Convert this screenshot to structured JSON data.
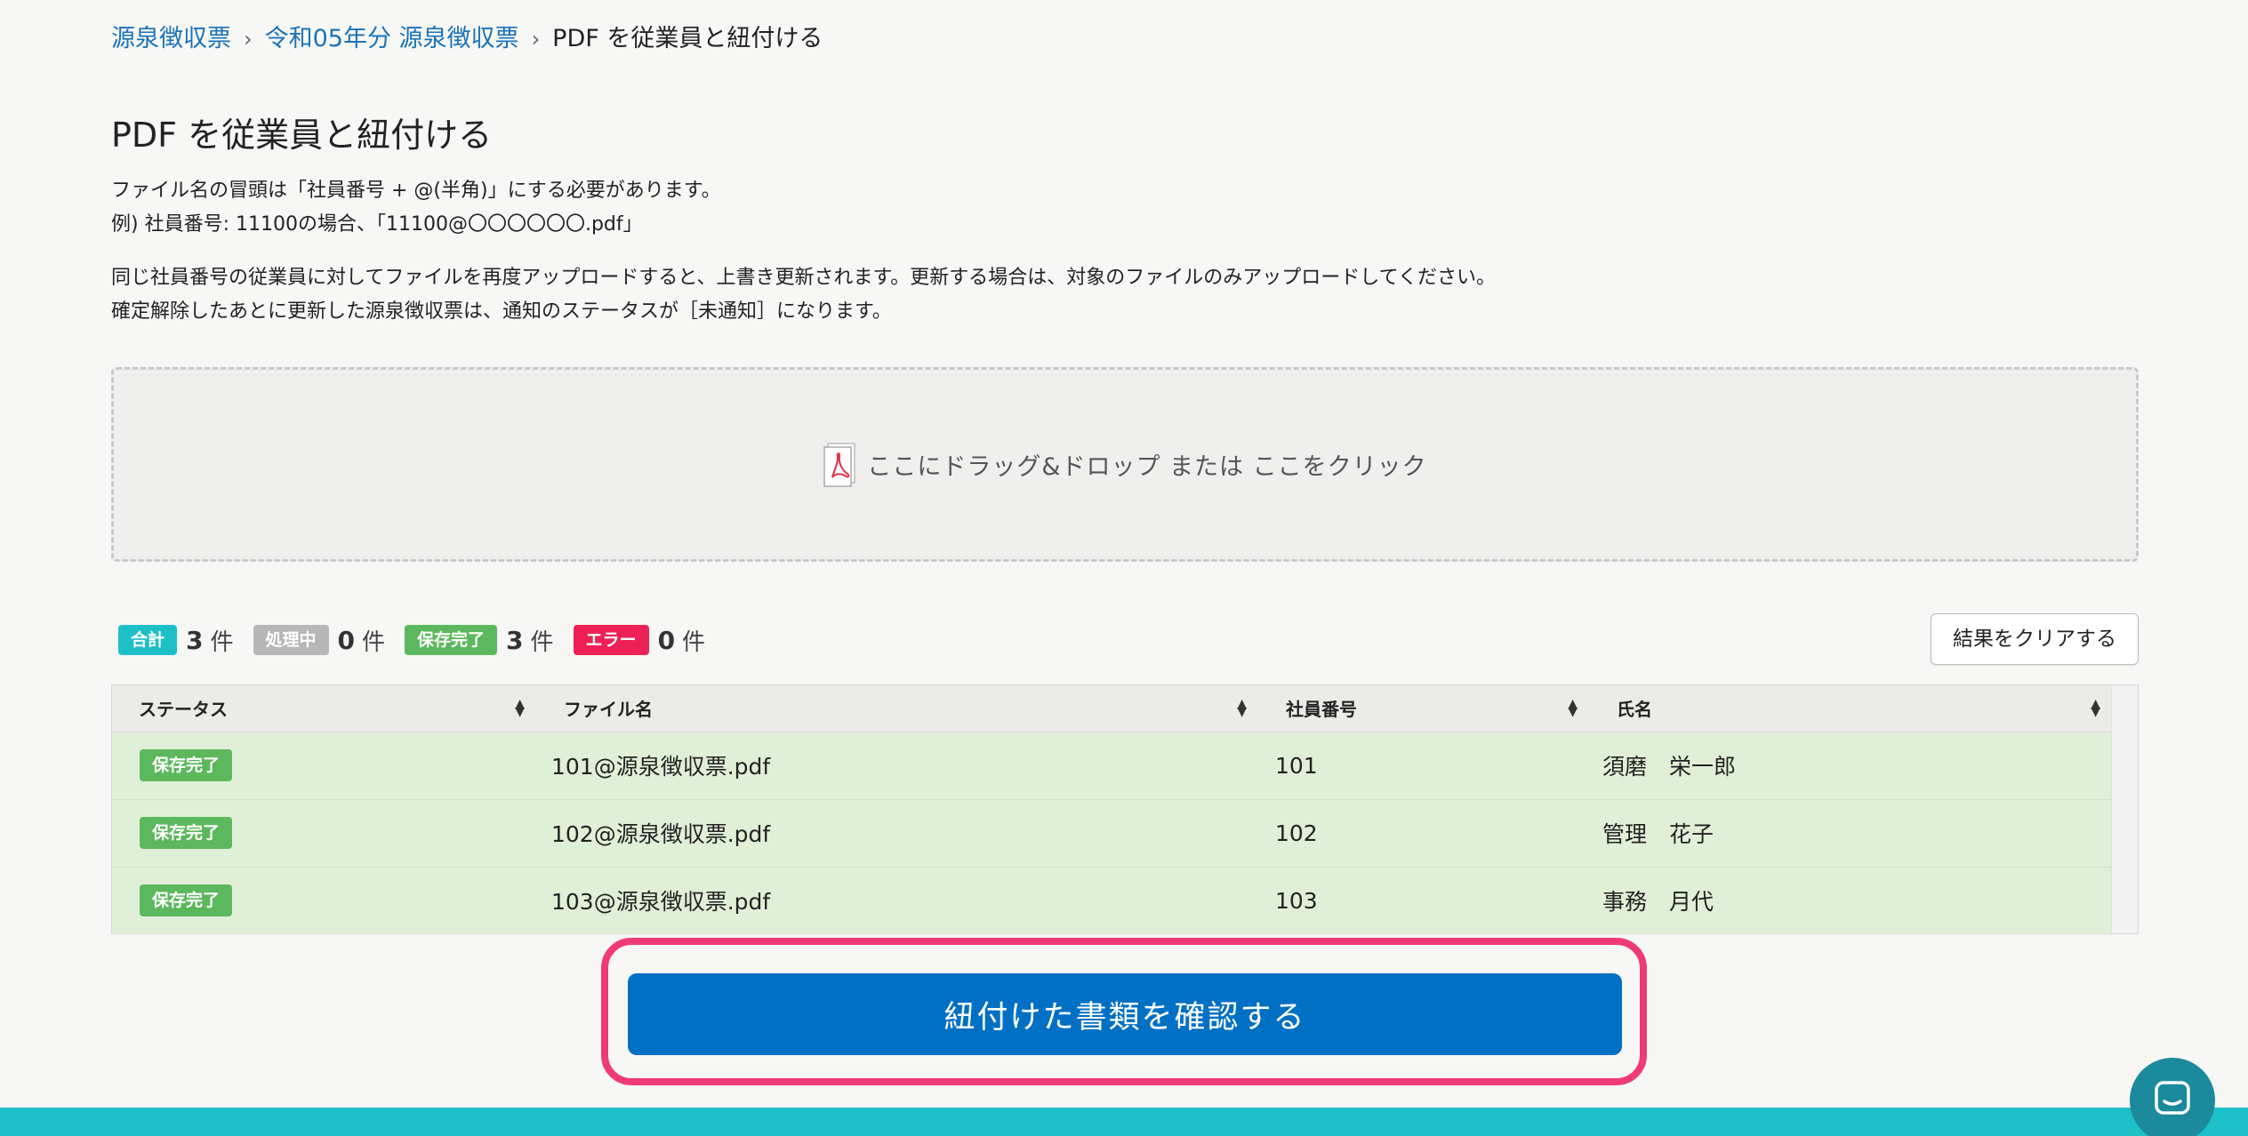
{
  "breadcrumb": {
    "items": [
      "源泉徴収票",
      "令和05年分 源泉徴収票"
    ],
    "current": "PDF を従業員と紐付ける",
    "separator": "›"
  },
  "page": {
    "title": "PDF を従業員と紐付ける",
    "desc1_line1": "ファイル名の冒頭は「社員番号 + @(半角)」にする必要があります。",
    "desc1_line2": "例) 社員番号: 11100の場合、「11100@〇〇〇〇〇〇.pdf」",
    "desc2_line1": "同じ社員番号の従業員に対してファイルを再度アップロードすると、上書き更新されます。更新する場合は、対象のファイルのみアップロードしてください。",
    "desc2_line2": "確定解除したあとに更新した源泉徴収票は、通知のステータスが［未通知］になります。"
  },
  "dropzone": {
    "text": "ここにドラッグ&ドロップ または ここをクリック",
    "icon": "pdf-file-icon"
  },
  "summary": {
    "unit": "件",
    "items": [
      {
        "label": "合計",
        "count": "3",
        "color": "#1ec0c8"
      },
      {
        "label": "処理中",
        "count": "0",
        "color": "#b7b7b7"
      },
      {
        "label": "保存完了",
        "count": "3",
        "color": "#5cb85c"
      },
      {
        "label": "エラー",
        "count": "0",
        "color": "#ee2157"
      }
    ]
  },
  "clear_button": "結果をクリアする",
  "table": {
    "headers": [
      "ステータス",
      "ファイル名",
      "社員番号",
      "氏名"
    ],
    "rows": [
      {
        "status": "保存完了",
        "file": "101@源泉徴収票.pdf",
        "number": "101",
        "name": "須磨　栄一郎"
      },
      {
        "status": "保存完了",
        "file": "102@源泉徴収票.pdf",
        "number": "102",
        "name": "管理　花子"
      },
      {
        "status": "保存完了",
        "file": "103@源泉徴収票.pdf",
        "number": "103",
        "name": "事務　月代"
      }
    ]
  },
  "confirm_button": "紐付けた書類を確認する",
  "colors": {
    "accent": "#0070c4",
    "highlight": "#ef3a78",
    "footer": "#1ec0c8",
    "saved_row": "#e0f0d8"
  }
}
